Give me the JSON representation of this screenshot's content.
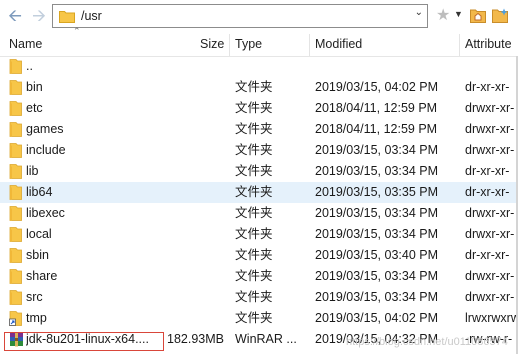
{
  "toolbar": {
    "path": "/usr"
  },
  "columns": {
    "name": "Name",
    "size": "Size",
    "type": "Type",
    "modified": "Modified",
    "attributes": "Attribute"
  },
  "files": [
    {
      "name": "..",
      "size": "",
      "type": "",
      "modified": "",
      "attributes": "",
      "icon": "folder-icon"
    },
    {
      "name": "bin",
      "size": "",
      "type": "文件夹",
      "modified": "2019/03/15, 04:02 PM",
      "attributes": "dr-xr-xr-",
      "icon": "folder-icon"
    },
    {
      "name": "etc",
      "size": "",
      "type": "文件夹",
      "modified": "2018/04/11, 12:59 PM",
      "attributes": "drwxr-xr-",
      "icon": "folder-icon"
    },
    {
      "name": "games",
      "size": "",
      "type": "文件夹",
      "modified": "2018/04/11, 12:59 PM",
      "attributes": "drwxr-xr-",
      "icon": "folder-icon"
    },
    {
      "name": "include",
      "size": "",
      "type": "文件夹",
      "modified": "2019/03/15, 03:34 PM",
      "attributes": "drwxr-xr-",
      "icon": "folder-icon"
    },
    {
      "name": "lib",
      "size": "",
      "type": "文件夹",
      "modified": "2019/03/15, 03:34 PM",
      "attributes": "dr-xr-xr-",
      "icon": "folder-icon"
    },
    {
      "name": "lib64",
      "size": "",
      "type": "文件夹",
      "modified": "2019/03/15, 03:35 PM",
      "attributes": "dr-xr-xr-",
      "icon": "folder-icon"
    },
    {
      "name": "libexec",
      "size": "",
      "type": "文件夹",
      "modified": "2019/03/15, 03:34 PM",
      "attributes": "drwxr-xr-",
      "icon": "folder-icon"
    },
    {
      "name": "local",
      "size": "",
      "type": "文件夹",
      "modified": "2019/03/15, 03:34 PM",
      "attributes": "drwxr-xr-",
      "icon": "folder-icon"
    },
    {
      "name": "sbin",
      "size": "",
      "type": "文件夹",
      "modified": "2019/03/15, 03:40 PM",
      "attributes": "dr-xr-xr-",
      "icon": "folder-icon"
    },
    {
      "name": "share",
      "size": "",
      "type": "文件夹",
      "modified": "2019/03/15, 03:34 PM",
      "attributes": "drwxr-xr-",
      "icon": "folder-icon"
    },
    {
      "name": "src",
      "size": "",
      "type": "文件夹",
      "modified": "2019/03/15, 03:34 PM",
      "attributes": "drwxr-xr-",
      "icon": "folder-icon"
    },
    {
      "name": "tmp",
      "size": "",
      "type": "文件夹",
      "modified": "2019/03/15, 04:02 PM",
      "attributes": "lrwxrwxrw",
      "icon": "shortcut-icon"
    },
    {
      "name": "jdk-8u201-linux-x64....",
      "size": "182.93MB",
      "type": "WinRAR ...",
      "modified": "2019/03/15, 04:32 PM",
      "attributes": "-rw-rw-r-",
      "icon": "winrar-archive-icon"
    }
  ],
  "hovered_row": 6,
  "selected_row": 13,
  "watermark": "https://blog.csdn.net/u011086574",
  "colors": {
    "folder": "#f7c648",
    "hover": "#e5f1fb",
    "selection_border": "#d9463a"
  }
}
